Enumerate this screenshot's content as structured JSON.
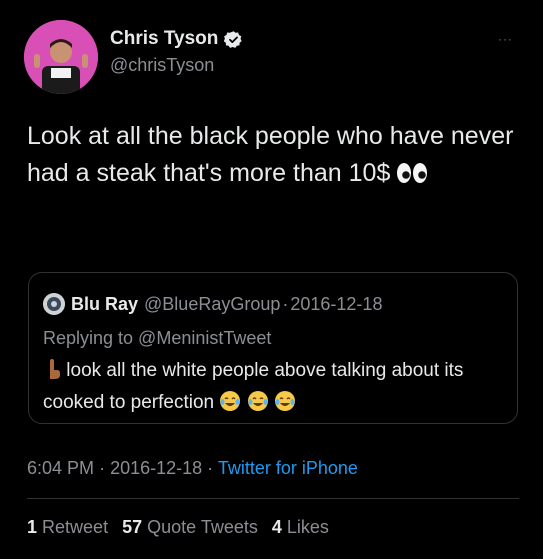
{
  "author": {
    "display_name": "Chris Tyson",
    "handle": "@chrisTyson",
    "verified": true,
    "avatar_bg": "#d84fb6"
  },
  "more_icon": "···",
  "tweet": {
    "text": "Look at all the black people who have never had a steak that's more than 10$",
    "trailing_emoji": "eyes"
  },
  "quoted": {
    "name": "Blu Ray",
    "handle": "@BlueRayGroup",
    "separator": "·",
    "date": "2016-12-18",
    "replying_to": "Replying to @MeninistTweet",
    "text": "look all the white people above talking about its cooked to perfection",
    "leading_emoji": "pointing-down-hand",
    "trailing_emoji": [
      "tears-of-joy",
      "tears-of-joy",
      "tears-of-joy"
    ]
  },
  "meta": {
    "time": "6:04 PM",
    "sep1": "·",
    "date": "2016-12-18",
    "sep2": "·",
    "source": "Twitter for iPhone"
  },
  "stats": {
    "retweets_count": "1",
    "retweets_label": "Retweet",
    "quotes_count": "57",
    "quotes_label": "Quote Tweets",
    "likes_count": "4",
    "likes_label": "Likes"
  },
  "colors": {
    "background": "#000000",
    "primary_text": "#e7e9ea",
    "secondary_text": "#8b8f94",
    "link": "#1d9bf0",
    "border": "#2f3336"
  }
}
